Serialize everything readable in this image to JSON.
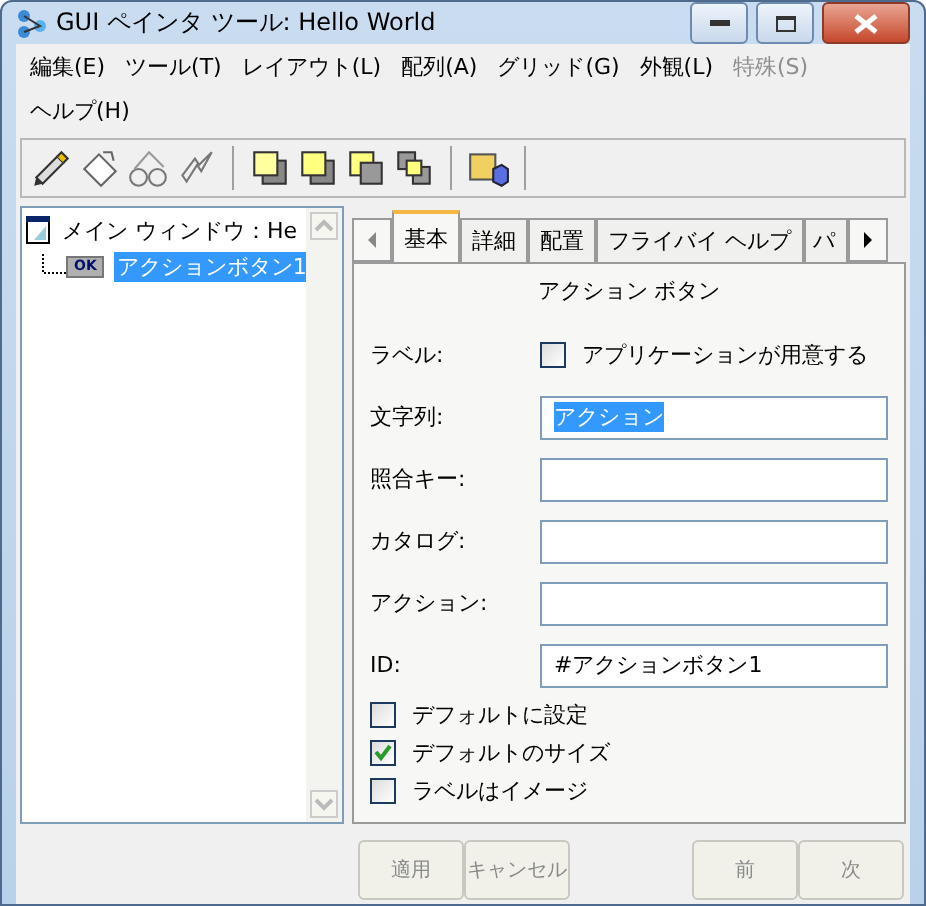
{
  "window": {
    "title": "GUI ペインタ ツール: Hello World"
  },
  "menu": [
    {
      "label": "編集(E)",
      "disabled": false
    },
    {
      "label": "ツール(T)",
      "disabled": false
    },
    {
      "label": "レイアウト(L)",
      "disabled": false
    },
    {
      "label": "配列(A)",
      "disabled": false
    },
    {
      "label": "グリッド(G)",
      "disabled": false
    },
    {
      "label": "外観(L)",
      "disabled": false
    },
    {
      "label": "特殊(S)",
      "disabled": true
    },
    {
      "label": "ヘルプ(H)",
      "disabled": false
    }
  ],
  "toolbar": [
    {
      "kind": "pencil"
    },
    {
      "kind": "erase"
    },
    {
      "kind": "glasses"
    },
    {
      "kind": "bolt"
    },
    {
      "kind": "sep"
    },
    {
      "kind": "front"
    },
    {
      "kind": "back"
    },
    {
      "kind": "forward"
    },
    {
      "kind": "backward"
    },
    {
      "kind": "sep"
    },
    {
      "kind": "widget"
    },
    {
      "kind": "sep"
    }
  ],
  "tree": {
    "label": "メイン ウィンドウ：He",
    "children": [
      {
        "label": "アクションボタン1",
        "badge": "OK",
        "selected": true
      }
    ]
  },
  "tabs": [
    {
      "label": "基本",
      "selected": true
    },
    {
      "label": "詳細",
      "selected": false
    },
    {
      "label": "配置",
      "selected": false
    },
    {
      "label": "フライバイ ヘルプ",
      "selected": false
    },
    {
      "label": "パ",
      "selected": false
    }
  ],
  "panel": {
    "title": "アクション ボタン",
    "label_row": {
      "label": "ラベル:",
      "checkbox": "アプリケーションが用意する",
      "checked": false
    },
    "fields": [
      {
        "label": "文字列:",
        "value": "アクション",
        "highlighted": true
      },
      {
        "label": "照合キー:"
      },
      {
        "label": "カタログ:"
      },
      {
        "label": "アクション:"
      },
      {
        "label": "ID:",
        "value": "#アクションボタン1",
        "highlighted": false
      }
    ],
    "options": [
      {
        "label": "デフォルトに設定",
        "checked": false
      },
      {
        "label": "デフォルトのサイズ",
        "checked": true
      },
      {
        "label": "ラベルはイメージ",
        "checked": false
      }
    ]
  },
  "buttons": [
    {
      "label": "適用",
      "disabled": true
    },
    {
      "label": "キャンセル",
      "disabled": true
    },
    {
      "label": "前",
      "disabled": true
    },
    {
      "label": "次",
      "disabled": true
    }
  ]
}
